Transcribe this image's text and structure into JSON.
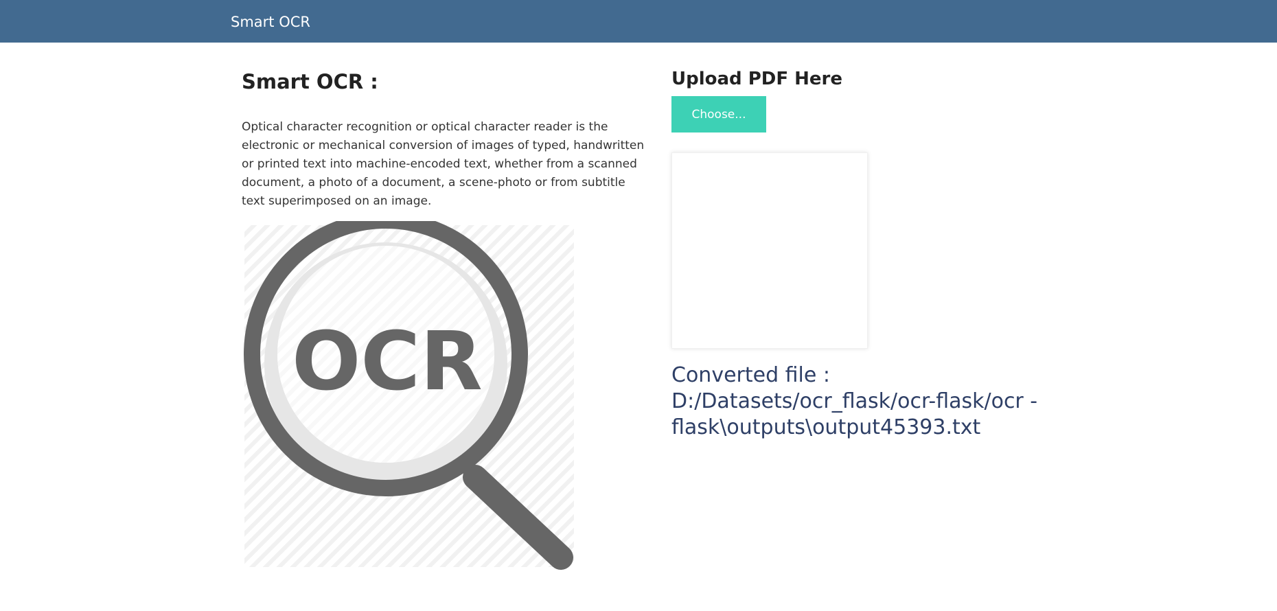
{
  "navbar": {
    "brand": "Smart OCR"
  },
  "main": {
    "title": "Smart OCR :",
    "description": "Optical character recognition or optical character reader is the electronic or mechanical conversion of images of typed, handwritten or printed text into machine-encoded text, whether from a scanned document, a photo of a document, a scene-photo or from subtitle text superimposed on an image.",
    "illustration_text": "OCR",
    "illustration_icon": "magnifier-ocr-icon"
  },
  "upload": {
    "title": "Upload PDF Here",
    "button_label": "Choose...",
    "converted_label": "Converted file :",
    "converted_path": "D:/Datasets/ocr_flask/ocr-flask/ocr - flask\\outputs\\output45393.txt"
  },
  "colors": {
    "navbar": "#426a90",
    "button": "#3dd1b5",
    "converted_text": "#2e3f66",
    "icon": "#666666"
  }
}
